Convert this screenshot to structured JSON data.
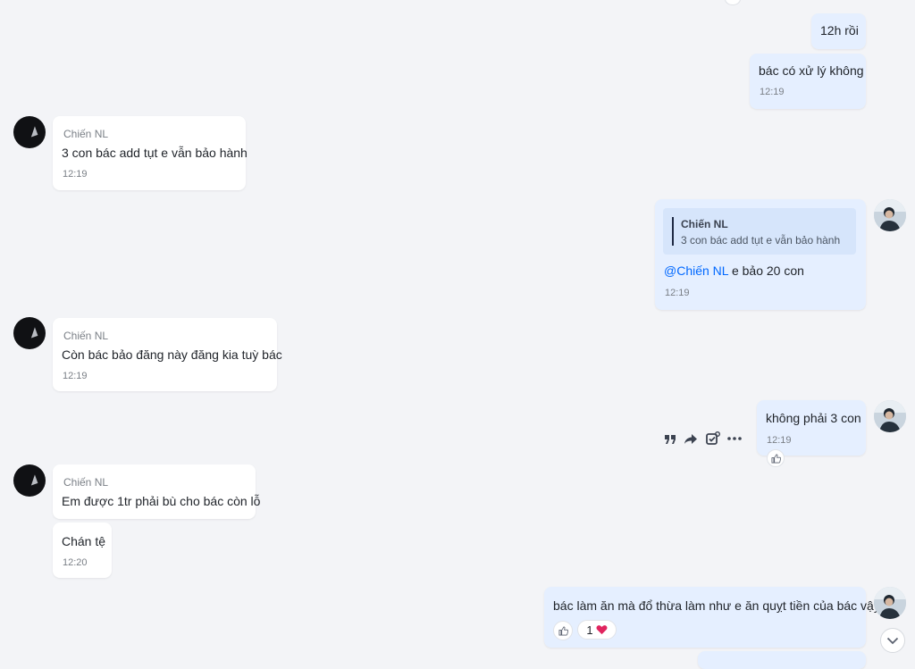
{
  "messages": {
    "m1": {
      "text": "12h rồi"
    },
    "m2": {
      "text": "bác có xử lý không",
      "time": "12:19"
    },
    "m3": {
      "sender": "Chiến NL",
      "text": "3 con bác add tụt e vẫn bảo hành",
      "time": "12:19"
    },
    "m4": {
      "quote_author": "Chiến NL",
      "quote_text": "3 con bác add tụt e vẫn bảo hành",
      "mention": "@Chiến NL",
      "text": " e bảo 20 con",
      "time": "12:19"
    },
    "m5": {
      "sender": "Chiến NL",
      "text": "Còn bác bảo đăng này đăng kia tuỳ bác",
      "time": "12:19"
    },
    "m6": {
      "text": "không phải 3 con",
      "time": "12:19"
    },
    "m7": {
      "sender": "Chiến NL",
      "text": "Em được 1tr phải bù cho bác còn lỗ"
    },
    "m8": {
      "text": "Chán tệ",
      "time": "12:20"
    },
    "m9": {
      "text": "bác làm ăn mà đổ thừa làm như e ăn quỵt tiền của bác vậy",
      "reaction_count": "1"
    }
  },
  "icons": {
    "quote": "quote-icon",
    "forward": "forward-icon",
    "task": "add-task-icon",
    "more": "more-icon",
    "like": "thumbs-up-icon",
    "heart": "heart-icon",
    "scroll": "chevron-down-icon"
  },
  "colors": {
    "outgoing_bubble": "#e5efff",
    "incoming_bubble": "#ffffff",
    "mention": "#0068ff",
    "heart": "#e0245e"
  }
}
